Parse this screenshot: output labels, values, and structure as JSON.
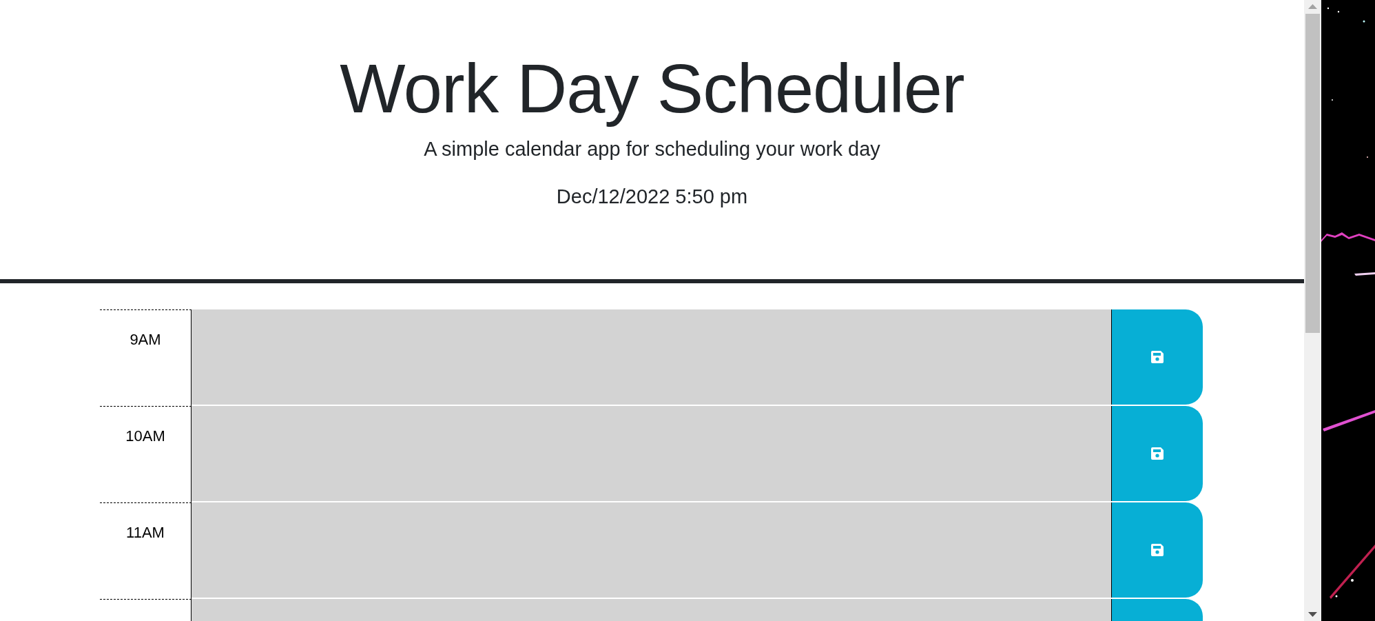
{
  "header": {
    "title": "Work Day Scheduler",
    "subtitle": "A simple calendar app for scheduling your work day",
    "current_day": "Dec/12/2022 5:50 pm"
  },
  "time_blocks": [
    {
      "hour": "9AM",
      "color": "#d3d3d3"
    },
    {
      "hour": "10AM",
      "color": "#d3d3d3"
    },
    {
      "hour": "11AM",
      "color": "#d3d3d3"
    },
    {
      "color": "#d3d3d3"
    }
  ]
}
